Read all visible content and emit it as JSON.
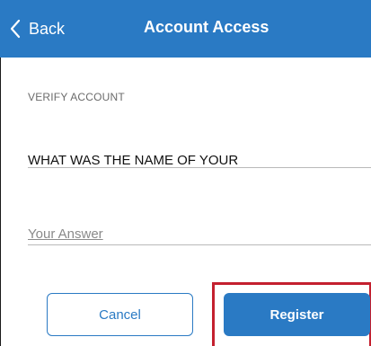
{
  "navbar": {
    "back_label": "Back",
    "back_icon": "chevron-left-icon",
    "title": "Account Access",
    "background_color": "#2a7ac4"
  },
  "verify": {
    "section_label": "VERIFY ACCOUNT",
    "question": "WHAT WAS THE NAME OF YOUR",
    "answer_value": "",
    "answer_placeholder": "Your Answer"
  },
  "actions": {
    "cancel_label": "Cancel",
    "register_label": "Register",
    "highlight_color": "#c4202f"
  }
}
